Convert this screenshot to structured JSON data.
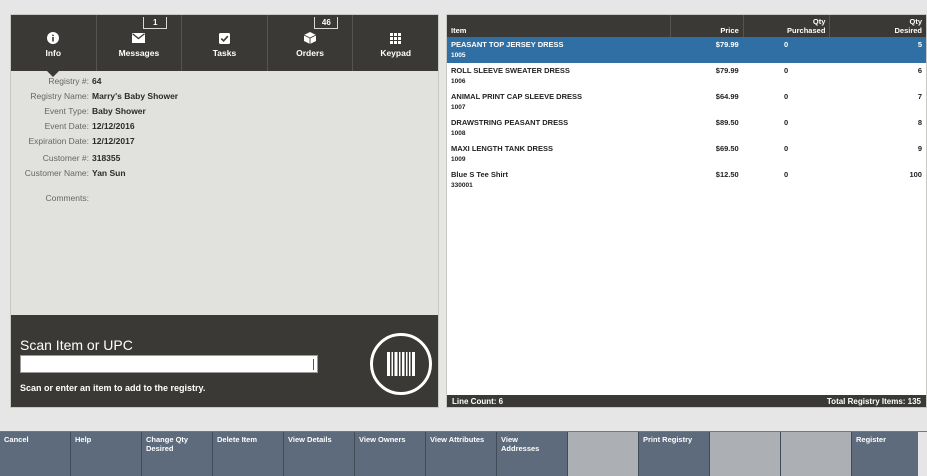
{
  "tabs": [
    {
      "label": "Info",
      "icon": "info-icon",
      "badge": ""
    },
    {
      "label": "Messages",
      "icon": "envelope-icon",
      "badge": "1"
    },
    {
      "label": "Tasks",
      "icon": "checkbox-icon",
      "badge": ""
    },
    {
      "label": "Orders",
      "icon": "box-icon",
      "badge": "46"
    },
    {
      "label": "Keypad",
      "icon": "keypad-icon",
      "badge": ""
    }
  ],
  "info": {
    "registry_num_label": "Registry #:",
    "registry_num": "64",
    "registry_name_label": "Registry Name:",
    "registry_name": "Marry's Baby Shower",
    "event_type_label": "Event Type:",
    "event_type": "Baby Shower",
    "event_date_label": "Event Date:",
    "event_date": "12/12/2016",
    "expiration_label": "Expiration Date:",
    "expiration": "12/12/2017",
    "customer_num_label": "Customer #:",
    "customer_num": "318355",
    "customer_name_label": "Customer Name:",
    "customer_name": "Yan Sun",
    "comments_label": "Comments:"
  },
  "scan": {
    "title": "Scan Item or UPC",
    "value": "",
    "hint": "Scan or enter an item to add to the registry."
  },
  "table": {
    "headers": {
      "item": "Item",
      "price": "Price",
      "qty_purchased_1": "Qty",
      "qty_purchased_2": "Purchased",
      "qty_desired_1": "Qty",
      "qty_desired_2": "Desired"
    },
    "rows": [
      {
        "name": "PEASANT TOP JERSEY DRESS",
        "sku": "1005",
        "price": "$79.99",
        "purchased": "0",
        "desired": "5"
      },
      {
        "name": "ROLL SLEEVE SWEATER DRESS",
        "sku": "1006",
        "price": "$79.99",
        "purchased": "0",
        "desired": "6"
      },
      {
        "name": "ANIMAL PRINT CAP SLEEVE DRESS",
        "sku": "1007",
        "price": "$64.99",
        "purchased": "0",
        "desired": "7"
      },
      {
        "name": "DRAWSTRING PEASANT DRESS",
        "sku": "1008",
        "price": "$89.50",
        "purchased": "0",
        "desired": "8"
      },
      {
        "name": "MAXI LENGTH TANK DRESS",
        "sku": "1009",
        "price": "$69.50",
        "purchased": "0",
        "desired": "9"
      },
      {
        "name": "Blue S Tee Shirt",
        "sku": "330001",
        "price": "$12.50",
        "purchased": "0",
        "desired": "100"
      }
    ],
    "line_count": "Line Count: 6",
    "total_items": "Total Registry Items: 135"
  },
  "buttons": {
    "cancel": "Cancel",
    "help": "Help",
    "change_qty_1": "Change Qty",
    "change_qty_2": "Desired",
    "delete_item": "Delete Item",
    "view_details": "View Details",
    "view_owners": "View Owners",
    "view_attributes": "View Attributes",
    "view_addresses_1": "View",
    "view_addresses_2": "Addresses",
    "print_registry": "Print Registry",
    "register": "Register"
  },
  "colors": {
    "dark": "#3a3935",
    "selected": "#2f6fa4",
    "button": "#5d6b7c",
    "button_empty": "#acb0b5"
  }
}
